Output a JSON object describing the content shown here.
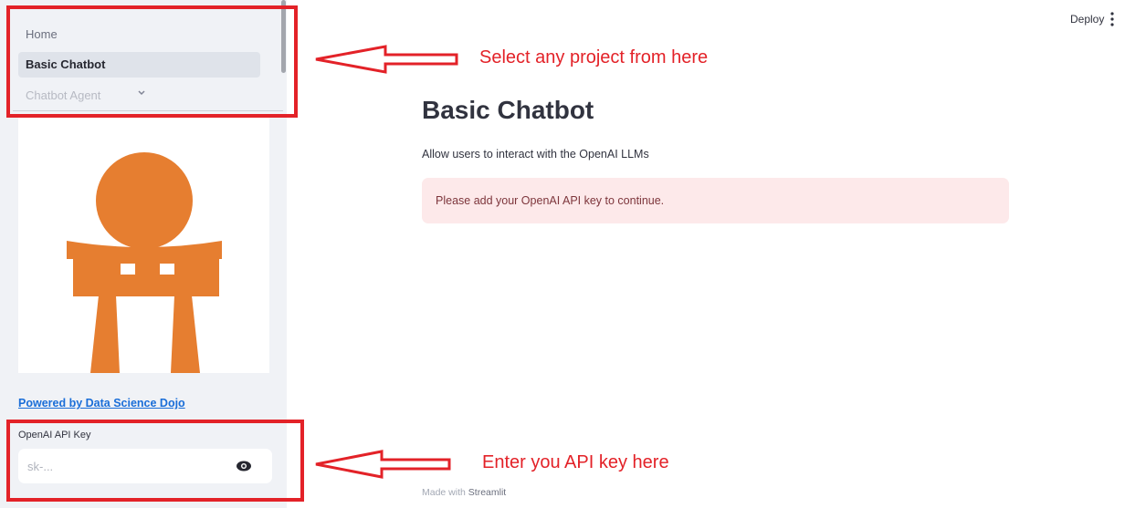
{
  "sidebar": {
    "nav_items": [
      {
        "label": "Home",
        "active": false
      },
      {
        "label": "Basic Chatbot",
        "active": true
      },
      {
        "label": "Chatbot Agent",
        "active": false
      }
    ],
    "expand_icon": "chevron-down-icon",
    "logo_icon": "torii-gate-icon",
    "logo_color": "#e67e30",
    "powered_by_link": "Powered by Data Science Dojo",
    "api_key": {
      "label": "OpenAI API Key",
      "placeholder": "sk-...",
      "value": "",
      "visibility_icon": "eye-icon"
    }
  },
  "header": {
    "deploy_label": "Deploy",
    "menu_icon": "vertical-dots-icon"
  },
  "main": {
    "title": "Basic Chatbot",
    "description": "Allow users to interact with the OpenAI LLMs",
    "alert": {
      "text": "Please add your OpenAI API key to continue.",
      "background": "#fde9ea",
      "text_color": "#7d353b"
    }
  },
  "footer": {
    "prefix": "Made with",
    "brand": "Streamlit"
  },
  "annotations": {
    "color": "#e32228",
    "top_note": "Select any project from here",
    "bottom_note": "Enter you API key here"
  }
}
